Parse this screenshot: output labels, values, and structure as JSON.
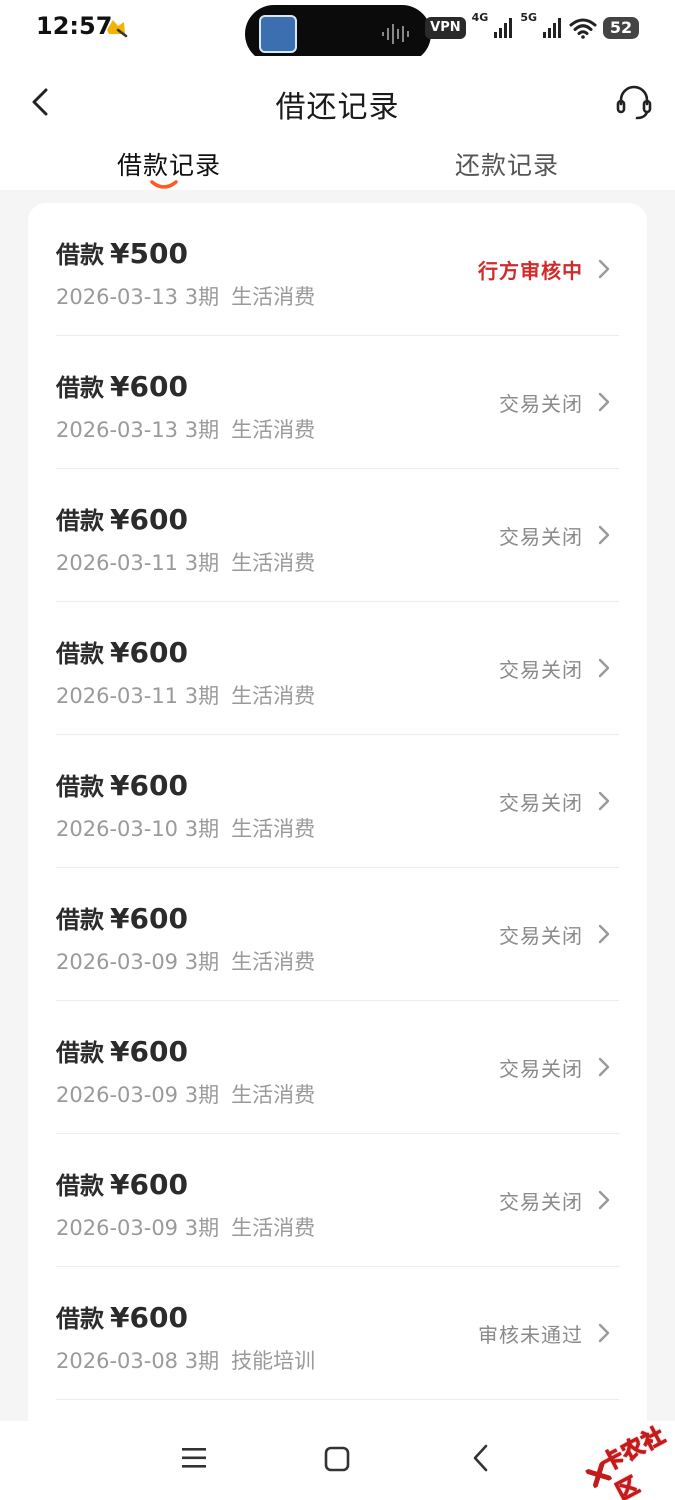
{
  "status_bar": {
    "time": "12:57",
    "vpn": "VPN",
    "net1": "4G",
    "net2": "5G",
    "battery": "52"
  },
  "header": {
    "title": "借还记录"
  },
  "tabs": [
    {
      "label": "借款记录",
      "active": true
    },
    {
      "label": "还款记录",
      "active": false
    }
  ],
  "accent_color": "#ff5a1f",
  "status_red": "#d12a2a",
  "records": [
    {
      "label": "借款",
      "amount": "¥500",
      "date": "2026-03-13",
      "term": "3期",
      "purpose": "生活消费",
      "status": "行方审核中"
    },
    {
      "label": "借款",
      "amount": "¥600",
      "date": "2026-03-13",
      "term": "3期",
      "purpose": "生活消费",
      "status": "交易关闭"
    },
    {
      "label": "借款",
      "amount": "¥600",
      "date": "2026-03-11",
      "term": "3期",
      "purpose": "生活消费",
      "status": "交易关闭"
    },
    {
      "label": "借款",
      "amount": "¥600",
      "date": "2026-03-11",
      "term": "3期",
      "purpose": "生活消费",
      "status": "交易关闭"
    },
    {
      "label": "借款",
      "amount": "¥600",
      "date": "2026-03-10",
      "term": "3期",
      "purpose": "生活消费",
      "status": "交易关闭"
    },
    {
      "label": "借款",
      "amount": "¥600",
      "date": "2026-03-09",
      "term": "3期",
      "purpose": "生活消费",
      "status": "交易关闭"
    },
    {
      "label": "借款",
      "amount": "¥600",
      "date": "2026-03-09",
      "term": "3期",
      "purpose": "生活消费",
      "status": "交易关闭"
    },
    {
      "label": "借款",
      "amount": "¥600",
      "date": "2026-03-09",
      "term": "3期",
      "purpose": "生活消费",
      "status": "交易关闭"
    },
    {
      "label": "借款",
      "amount": "¥600",
      "date": "2026-03-08",
      "term": "3期",
      "purpose": "技能培训",
      "status": "审核未通过"
    }
  ],
  "watermark": {
    "text": "卡农社区"
  }
}
